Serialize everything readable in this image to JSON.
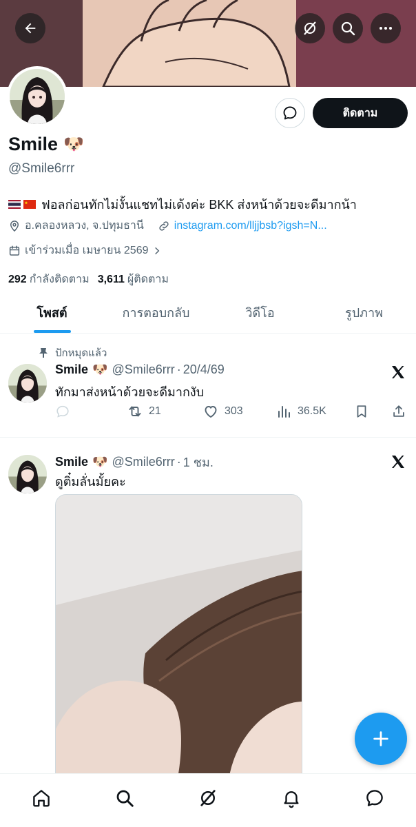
{
  "header": {
    "back_icon": "arrow-left-icon",
    "grok_icon": "grok-icon",
    "search_icon": "search-icon",
    "more_icon": "more-horizontal-icon"
  },
  "profile": {
    "name": "Smile",
    "name_emoji": "🐶",
    "handle": "@Smile6rrr",
    "bio": "ฟอลก่อนทักไม่งั้นแชทไม่เด้งค่ะ BKK ส่งหน้าด้วยจะดีมากน้า",
    "location": "อ.คลองหลวง, จ.ปทุมธานี",
    "website": "instagram.com/lljjbsb?igsh=N...",
    "joined": "เข้าร่วมเมื่อ เมษายน 2569",
    "following_count": "292",
    "following_label": "กำลังติดตาม",
    "followers_count": "3,611",
    "followers_label": "ผู้ติดตาม",
    "follow_button": "ติดตาม"
  },
  "tabs": [
    "โพสต์",
    "การตอบกลับ",
    "วิดีโอ",
    "รูปภาพ"
  ],
  "pinned_post": {
    "pinned_label": "ปักหมุดแล้ว",
    "name": "Smile",
    "name_emoji": "🐶",
    "handle": "@Smile6rrr",
    "sep": "·",
    "time": "20/4/69",
    "text": "ทักมาส่งหน้าด้วยจะดีมากงับ",
    "reposts": "21",
    "likes": "303",
    "views": "36.5K"
  },
  "post2": {
    "name": "Smile",
    "name_emoji": "🐶",
    "handle": "@Smile6rrr",
    "sep": "·",
    "time": "1 ชม.",
    "text": "ดูติ๋มลั่นมั้ยคะ"
  },
  "colors": {
    "accent": "#1d9bf0",
    "text": "#0f1419",
    "secondary": "#536471"
  }
}
